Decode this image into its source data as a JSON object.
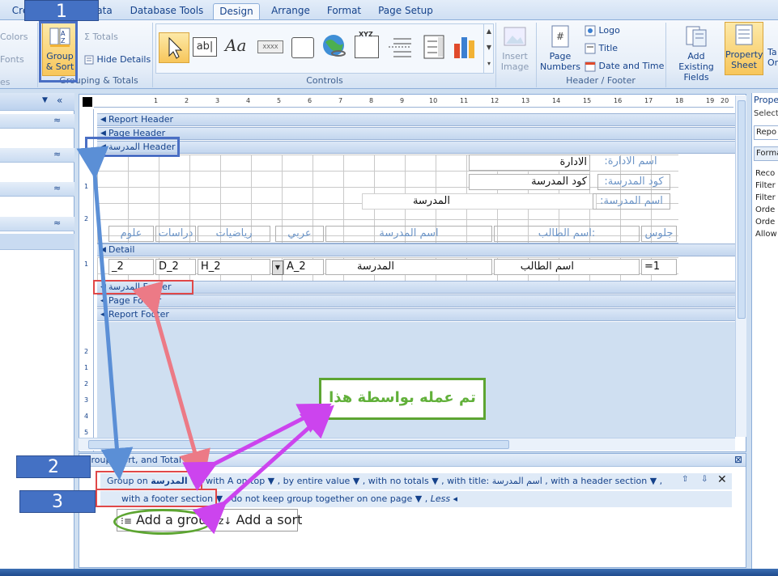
{
  "tabs": [
    "Cre",
    "ata",
    "Database Tools",
    "Design",
    "Arrange",
    "Format",
    "Page Setup"
  ],
  "ribbon": {
    "colors": "Colors",
    "fonts": "Fonts",
    "group_sort": [
      "Group",
      "& Sort"
    ],
    "totals": "Σ Totals",
    "hide_details": "Hide Details",
    "grouping_label": "Grouping & Totals",
    "controls_label": "Controls",
    "logo": "Logo",
    "title": "Title",
    "date_time": "Date and Time",
    "page_numbers": [
      "Page",
      "Numbers"
    ],
    "insert_image": [
      "Insert",
      "Image"
    ],
    "header_footer_label": "Header / Footer",
    "add_existing": [
      "Add Existing",
      "Fields"
    ],
    "property_sheet": [
      "Property",
      "Sheet"
    ],
    "ta": [
      "Ta",
      "Or"
    ],
    "left_es": "es",
    "textbox_label": "ab|",
    "aa_label": "Aa",
    "xxxx": "XXXX",
    "xyz": "XYZ"
  },
  "sections": {
    "report_header": "Report Header",
    "page_header": "Page Header",
    "school_header": "المدرسة Header",
    "detail": "Detail",
    "school_footer": "المدرسة Footer",
    "page_footer": "Page Footer",
    "report_footer": "Report Footer"
  },
  "header_fields": {
    "admin_value": "الادارة",
    "admin_label": "اسم الادارة:",
    "code_value": "كود المدرسة",
    "code_label": "كود المدرسة:",
    "school_value": "المدرسة",
    "school_label": "اسم المدرسة:"
  },
  "column_labels": [
    "علوم",
    "دراسات",
    "رياضيات",
    "عربي",
    "اسم المدرسة",
    "اسم الطالب:",
    "جلوس"
  ],
  "detail_fields": [
    "_2",
    "D_2",
    "H_2",
    "A_2",
    "المدرسة",
    "اسم الطالب",
    "=1"
  ],
  "ruler_numbers": [
    "1",
    "2",
    "3",
    "4",
    "5",
    "6",
    "7",
    "8",
    "9",
    "10",
    "11",
    "12",
    "13",
    "14",
    "15",
    "16",
    "17",
    "18",
    "19",
    "20"
  ],
  "vruler_numbers": [
    "1",
    "2",
    "1",
    "2",
    "1",
    "2",
    "3",
    "4",
    "5"
  ],
  "gst": {
    "title": "Group, Sort, and Total",
    "group_on": "Group on",
    "field": "المدرسة",
    "with_a_on_top": "with A on top",
    "by_entire_value": "by entire value",
    "with_no_totals": "with no totals",
    "with_title": "with title",
    "title_value": "اسم المدرسة",
    "with_header": "with a header section",
    "with_footer": "with a footer section",
    "keep_together": "do not keep group together on one page",
    "less": "Less",
    "add_group": "Add a group",
    "add_sort": "Add a sort"
  },
  "props": {
    "title": "Prope",
    "select": "Select",
    "repo": "Repo",
    "format": "Forma",
    "rows": [
      "Reco",
      "Filter",
      "Filter",
      "Orde",
      "Orde",
      "Allow"
    ]
  },
  "callouts": [
    "1",
    "2",
    "3"
  ],
  "note": "تم عمله بواسطة هذا",
  "colors": {
    "callout_blue": "#4471c4",
    "red_box": "#e04848",
    "green": "#5da532",
    "arrow_blue": "#5b8fd6",
    "arrow_pink": "#ec7a86",
    "arrow_purple": "#cc44ee"
  }
}
